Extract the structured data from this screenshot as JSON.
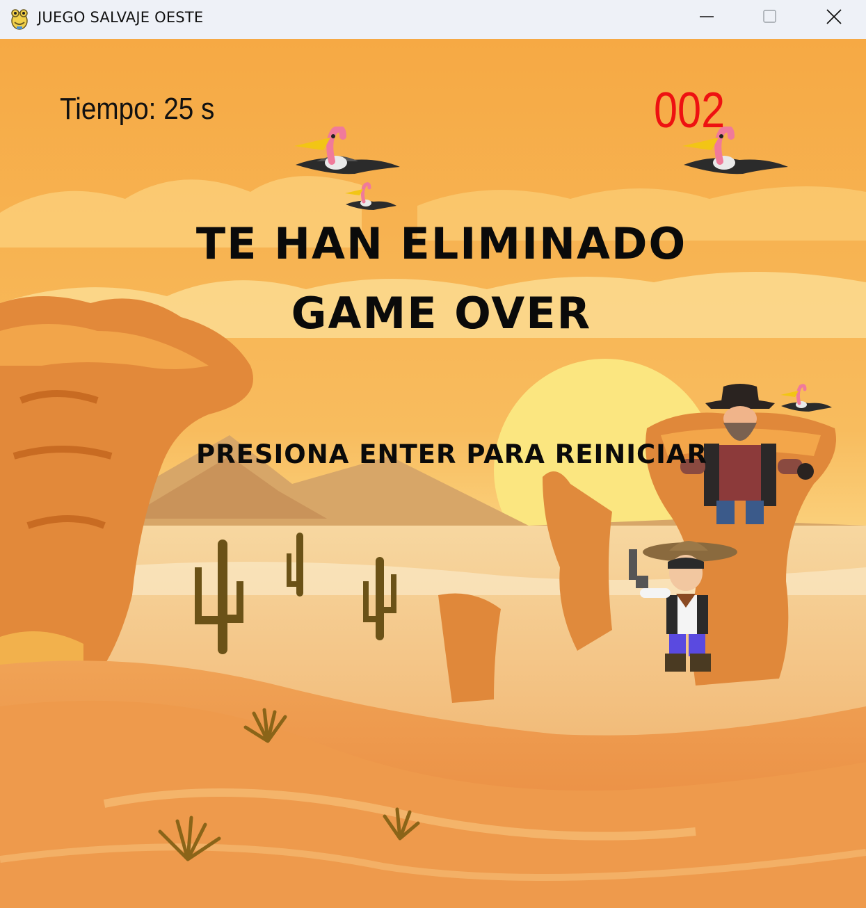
{
  "window": {
    "title": "JUEGO SALVAJE OESTE",
    "icon": "pygame-snake-icon",
    "controls": [
      "minimize-icon",
      "maximize-icon",
      "close-icon"
    ]
  },
  "hud": {
    "time_label": "Tiempo: 25 s",
    "score": "002",
    "score_color": "#ee1111"
  },
  "overlay": {
    "line1": "TE HAN ELIMINADO",
    "line2": "GAME OVER",
    "prompt": "PRESIONA ENTER PARA REINICIAR"
  },
  "scene": {
    "background": "desert-canyon-sunset",
    "colors": {
      "sky": "#f7b04a",
      "sun": "#fbe37a",
      "rock": "#e08a36",
      "sand": "#f0b86c"
    },
    "sprites": [
      "vulture-sprite",
      "vulture-sprite",
      "vulture-small-sprite",
      "vulture-small-sprite",
      "bandit-enemy-sprite",
      "cowboy-player-sprite"
    ]
  }
}
